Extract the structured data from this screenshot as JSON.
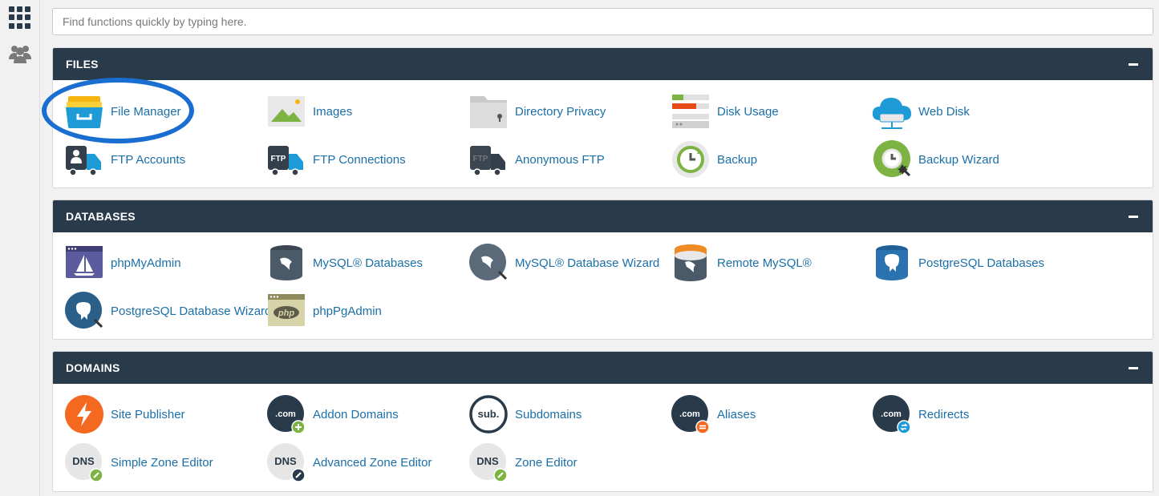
{
  "search": {
    "placeholder": "Find functions quickly by typing here."
  },
  "sidebar": {
    "items": [
      {
        "icon": "apps-grid-icon"
      },
      {
        "icon": "users-icon"
      }
    ]
  },
  "panels": [
    {
      "title": "FILES",
      "items": [
        {
          "label": "File Manager",
          "icon": "file-manager-icon"
        },
        {
          "label": "Images",
          "icon": "images-icon"
        },
        {
          "label": "Directory Privacy",
          "icon": "directory-privacy-icon"
        },
        {
          "label": "Disk Usage",
          "icon": "disk-usage-icon"
        },
        {
          "label": "Web Disk",
          "icon": "web-disk-icon"
        },
        {
          "label": "FTP Accounts",
          "icon": "ftp-accounts-icon"
        },
        {
          "label": "FTP Connections",
          "icon": "ftp-connections-icon"
        },
        {
          "label": "Anonymous FTP",
          "icon": "anonymous-ftp-icon"
        },
        {
          "label": "Backup",
          "icon": "backup-icon"
        },
        {
          "label": "Backup Wizard",
          "icon": "backup-wizard-icon"
        }
      ]
    },
    {
      "title": "DATABASES",
      "items": [
        {
          "label": "phpMyAdmin",
          "icon": "phpmyadmin-icon"
        },
        {
          "label": "MySQL® Databases",
          "icon": "mysql-databases-icon"
        },
        {
          "label": "MySQL® Database Wizard",
          "icon": "mysql-database-wizard-icon"
        },
        {
          "label": "Remote MySQL®",
          "icon": "remote-mysql-icon"
        },
        {
          "label": "PostgreSQL Databases",
          "icon": "postgresql-databases-icon"
        },
        {
          "label": "PostgreSQL Database Wizard",
          "icon": "postgresql-wizard-icon"
        },
        {
          "label": "phpPgAdmin",
          "icon": "phppgadmin-icon"
        }
      ]
    },
    {
      "title": "DOMAINS",
      "items": [
        {
          "label": "Site Publisher",
          "icon": "site-publisher-icon"
        },
        {
          "label": "Addon Domains",
          "icon": "addon-domains-icon"
        },
        {
          "label": "Subdomains",
          "icon": "subdomains-icon"
        },
        {
          "label": "Aliases",
          "icon": "aliases-icon"
        },
        {
          "label": "Redirects",
          "icon": "redirects-icon"
        },
        {
          "label": "Simple Zone Editor",
          "icon": "simple-zone-editor-icon"
        },
        {
          "label": "Advanced Zone Editor",
          "icon": "advanced-zone-editor-icon"
        },
        {
          "label": "Zone Editor",
          "icon": "zone-editor-icon"
        }
      ]
    }
  ],
  "icon_text": {
    "ftp": "FTP",
    "com": ".com",
    "sub": "sub.",
    "dns": "DNS",
    "php": "php"
  },
  "colors": {
    "header": "#293a4a",
    "link": "#1b6fa8",
    "highlight": "#1a6dd1"
  }
}
